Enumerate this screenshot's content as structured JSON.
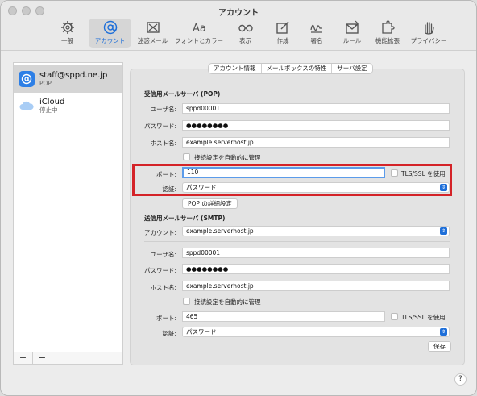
{
  "window": {
    "title": "アカウント"
  },
  "toolbar": {
    "items": [
      {
        "label": "一般",
        "icon": "gear-icon"
      },
      {
        "label": "アカウント",
        "icon": "at-icon"
      },
      {
        "label": "迷惑メール",
        "icon": "junk-icon"
      },
      {
        "label": "フォントとカラー",
        "icon": "font-icon"
      },
      {
        "label": "表示",
        "icon": "glasses-icon"
      },
      {
        "label": "作成",
        "icon": "compose-icon"
      },
      {
        "label": "署名",
        "icon": "signature-icon"
      },
      {
        "label": "ルール",
        "icon": "rules-icon"
      },
      {
        "label": "機能拡張",
        "icon": "extension-icon"
      },
      {
        "label": "プライバシー",
        "icon": "hand-icon"
      }
    ],
    "active_index": 1
  },
  "sidebar": {
    "accounts": [
      {
        "name": "staff@sppd.ne.jp",
        "sub": "POP"
      },
      {
        "name": "iCloud",
        "sub": "停止中"
      }
    ],
    "add_label": "+",
    "remove_label": "−"
  },
  "tabs": [
    "アカウント情報",
    "メールボックスの特性",
    "サーバ設定"
  ],
  "incoming": {
    "title": "受信用メールサーバ (POP)",
    "user_label": "ユーザ名:",
    "user_value": "sppd00001",
    "password_label": "パスワード:",
    "password_value": "●●●●●●●●",
    "host_label": "ホスト名:",
    "host_value": "example.serverhost.jp",
    "auto_manage_label": "接続設定を自動的に管理",
    "port_label": "ポート:",
    "port_value": "110",
    "tls_label": "TLS/SSL を使用",
    "auth_label": "認証:",
    "auth_value": "パスワード",
    "advanced_button": "POP の詳細設定"
  },
  "outgoing": {
    "title": "送信用メールサーバ (SMTP)",
    "account_label": "アカウント:",
    "account_value": "example.serverhost.jp",
    "user_label": "ユーザ名:",
    "user_value": "sppd00001",
    "password_label": "パスワード:",
    "password_value": "●●●●●●●●",
    "host_label": "ホスト名:",
    "host_value": "example.serverhost.jp",
    "auto_manage_label": "接続設定を自動的に管理",
    "port_label": "ポート:",
    "port_value": "465",
    "tls_label": "TLS/SSL を使用",
    "auth_label": "認証:",
    "auth_value": "パスワード",
    "save_button": "保存"
  },
  "help_label": "?",
  "colors": {
    "accent": "#1e6fd9",
    "highlight": "#d42328"
  }
}
